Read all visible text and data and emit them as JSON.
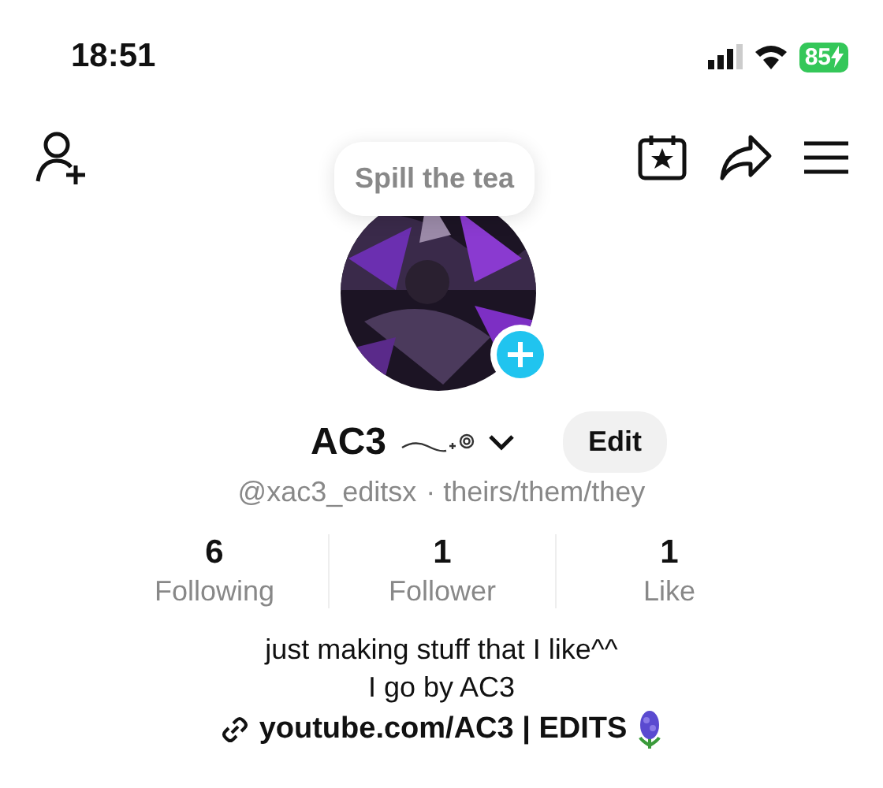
{
  "status_bar": {
    "time": "18:51",
    "battery": "85"
  },
  "tooltip": {
    "text": "Spill the tea"
  },
  "profile": {
    "name": "AC3",
    "handle": "@xac3_editsx",
    "pronouns": "· theirs/them/they",
    "edit_button": "Edit"
  },
  "stats": [
    {
      "value": "6",
      "label": "Following"
    },
    {
      "value": "1",
      "label": "Follower"
    },
    {
      "value": "1",
      "label": "Like"
    }
  ],
  "bio": [
    "just making stuff that I like^^",
    "I go by AC3"
  ],
  "link": "youtube.com/AC3 | EDITS"
}
